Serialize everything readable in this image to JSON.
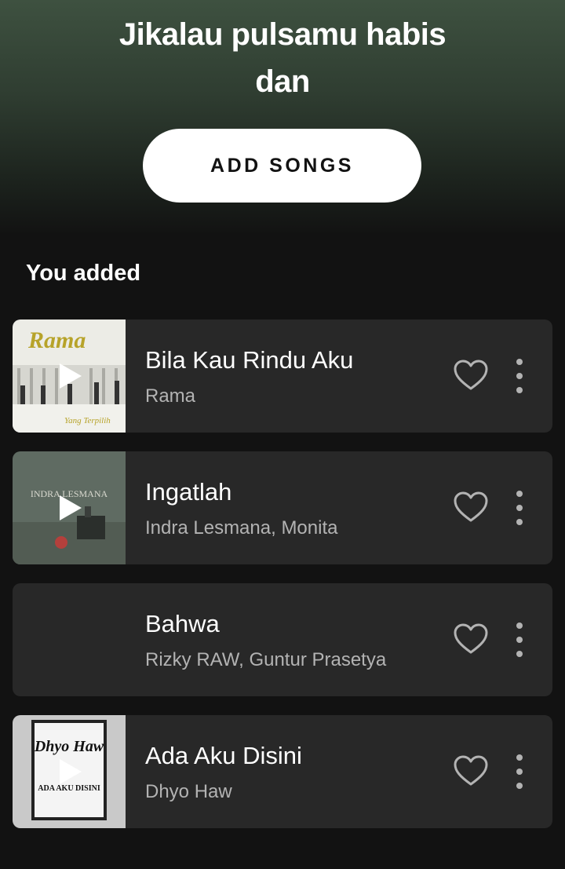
{
  "playlist": {
    "title_line1": "Jikalau pulsamu habis",
    "title_line2": "dan",
    "add_button_label": "ADD SONGS"
  },
  "section": {
    "title": "You added"
  },
  "tracks": [
    {
      "title": "Bila Kau Rindu Aku",
      "artist": "Rama",
      "cover": "cover-art-rama",
      "cover_text": "Rama",
      "cover_subtext": "Yang Terpilih"
    },
    {
      "title": "Ingatlah",
      "artist": "Indra Lesmana, Monita",
      "cover": "cover-art-indra-lesmana",
      "cover_text": "INDRA LESMANA",
      "cover_subtext": ""
    },
    {
      "title": "Bahwa",
      "artist": "Rizky RAW, Guntur Prasetya",
      "cover": "none",
      "cover_text": "",
      "cover_subtext": ""
    },
    {
      "title": "Ada Aku Disini",
      "artist": "Dhyo Haw",
      "cover": "cover-art-dhyo-haw",
      "cover_text": "Dhyo Haw",
      "cover_subtext": "ADA AKU DISINI"
    }
  ],
  "icons": {
    "play": "play-icon",
    "like": "heart-outline-icon",
    "more": "vertical-dots-icon"
  },
  "colors": {
    "background": "#121212",
    "header_gradient_top": "#3e5140",
    "card": "#282828",
    "secondary_text": "#b3b3b3",
    "icon": "#b3b3b3"
  }
}
